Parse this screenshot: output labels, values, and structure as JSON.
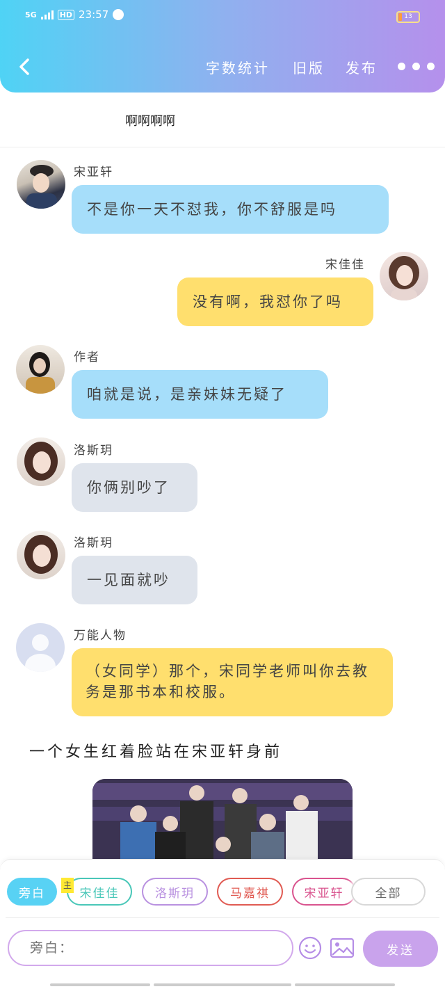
{
  "status_bar": {
    "network": "5G",
    "hd": "HD",
    "time": "23:57",
    "battery": "13"
  },
  "header": {
    "back_icon": "chevron-left-icon",
    "nav": [
      "字数统计",
      "旧版",
      "发布"
    ],
    "more_icon": "more-dots-icon"
  },
  "subtitle": "啊啊啊啊",
  "messages": [
    {
      "name": "宋亚轩",
      "text": "不是你一天不怼我，你不舒服是吗"
    },
    {
      "name": "宋佳佳",
      "text": "没有啊，我怼你了吗"
    },
    {
      "name": "作者",
      "text": "咱就是说，是亲妹妹无疑了"
    },
    {
      "name": "洛斯玥",
      "text": "你俩别吵了"
    },
    {
      "name": "洛斯玥",
      "text": "一见面就吵"
    },
    {
      "name": "万能人物",
      "text": "（女同学）那个，宋同学老师叫你去教务是那书本和校服。"
    }
  ],
  "narration": "一个女生红着脸站在宋亚轩身前",
  "roles": {
    "main_tag": "主",
    "chips": [
      "旁白",
      "宋佳佳",
      "洛斯玥",
      "马嘉祺",
      "宋亚轩",
      "全部"
    ]
  },
  "composer": {
    "placeholder": "旁白：",
    "send": "发送",
    "emoji_icon": "smiley-icon",
    "image_icon": "image-icon"
  },
  "colors": {
    "header_start": "#4fd3f5",
    "header_end": "#b590ec",
    "blue_bubble": "#a6defa",
    "yellow_bubble": "#ffdf6e",
    "grey_bubble": "#dfe4ec",
    "accent": "#c9a3ec"
  }
}
